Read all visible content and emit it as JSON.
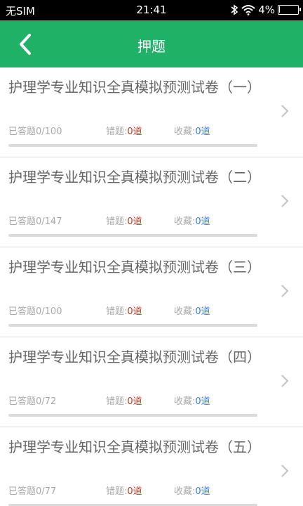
{
  "status_bar": {
    "carrier": "无SIM",
    "time": "21:41",
    "battery_text": "4%",
    "battery_level": 0.04
  },
  "header": {
    "title": "押题",
    "back_icon": "chevron-left-icon"
  },
  "colors": {
    "accent": "#1fb166",
    "wrong": "#c0392b",
    "favorite": "#3a7fd5"
  },
  "papers": [
    {
      "name": "护理学专业知识全真模拟预测试卷（一）",
      "answered_label": "已答题0/100",
      "answered": 0,
      "total": 100,
      "wrong_label": "错题:",
      "wrong_value": "0道",
      "fav_label": "收藏:",
      "fav_value": "0道"
    },
    {
      "name": "护理学专业知识全真模拟预测试卷（二）",
      "answered_label": "已答题0/147",
      "answered": 0,
      "total": 147,
      "wrong_label": "错题:",
      "wrong_value": "0道",
      "fav_label": "收藏:",
      "fav_value": "0道"
    },
    {
      "name": "护理学专业知识全真模拟预测试卷（三）",
      "answered_label": "已答题0/100",
      "answered": 0,
      "total": 100,
      "wrong_label": "错题:",
      "wrong_value": "0道",
      "fav_label": "收藏:",
      "fav_value": "0道"
    },
    {
      "name": "护理学专业知识全真模拟预测试卷（四）",
      "answered_label": "已答题0/72",
      "answered": 0,
      "total": 72,
      "wrong_label": "错题:",
      "wrong_value": "0道",
      "fav_label": "收藏:",
      "fav_value": "0道"
    },
    {
      "name": "护理学专业知识全真模拟预测试卷（五）",
      "answered_label": "已答题0/77",
      "answered": 0,
      "total": 77,
      "wrong_label": "错题:",
      "wrong_value": "0道",
      "fav_label": "收藏:",
      "fav_value": "0道"
    }
  ]
}
